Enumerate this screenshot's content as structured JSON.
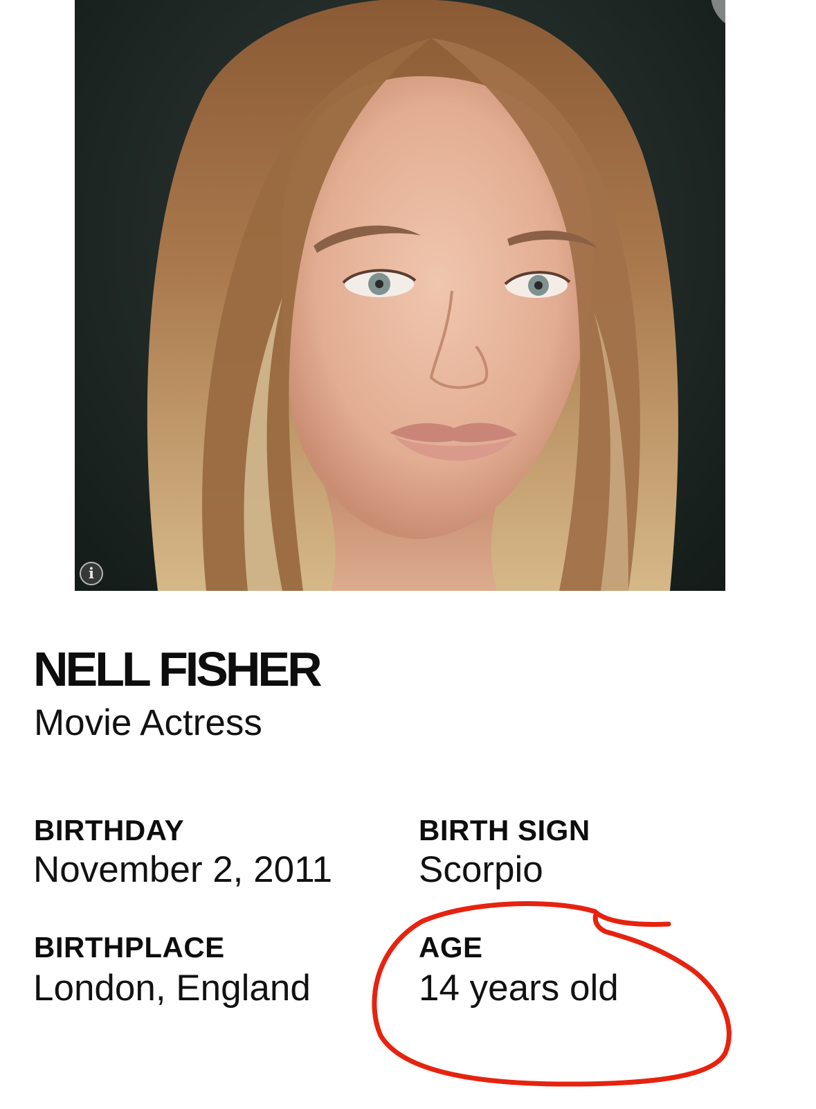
{
  "profile": {
    "name": "NELL FISHER",
    "occupation": "Movie Actress"
  },
  "facts": {
    "birthday": {
      "label": "BIRTHDAY",
      "value": "November 2, 2011"
    },
    "birth_sign": {
      "label": "BIRTH SIGN",
      "value": "Scorpio"
    },
    "birthplace": {
      "label": "BIRTHPLACE",
      "value": "London, England"
    },
    "age": {
      "label": "AGE",
      "value": "14 years old"
    }
  },
  "photo_controls": {
    "info_glyph": "i",
    "share_icon": "share-arrow-icon"
  },
  "colors": {
    "annotation_stroke": "#e5230f",
    "text": "#0d0d0d",
    "photo_background": "#1c2522"
  }
}
